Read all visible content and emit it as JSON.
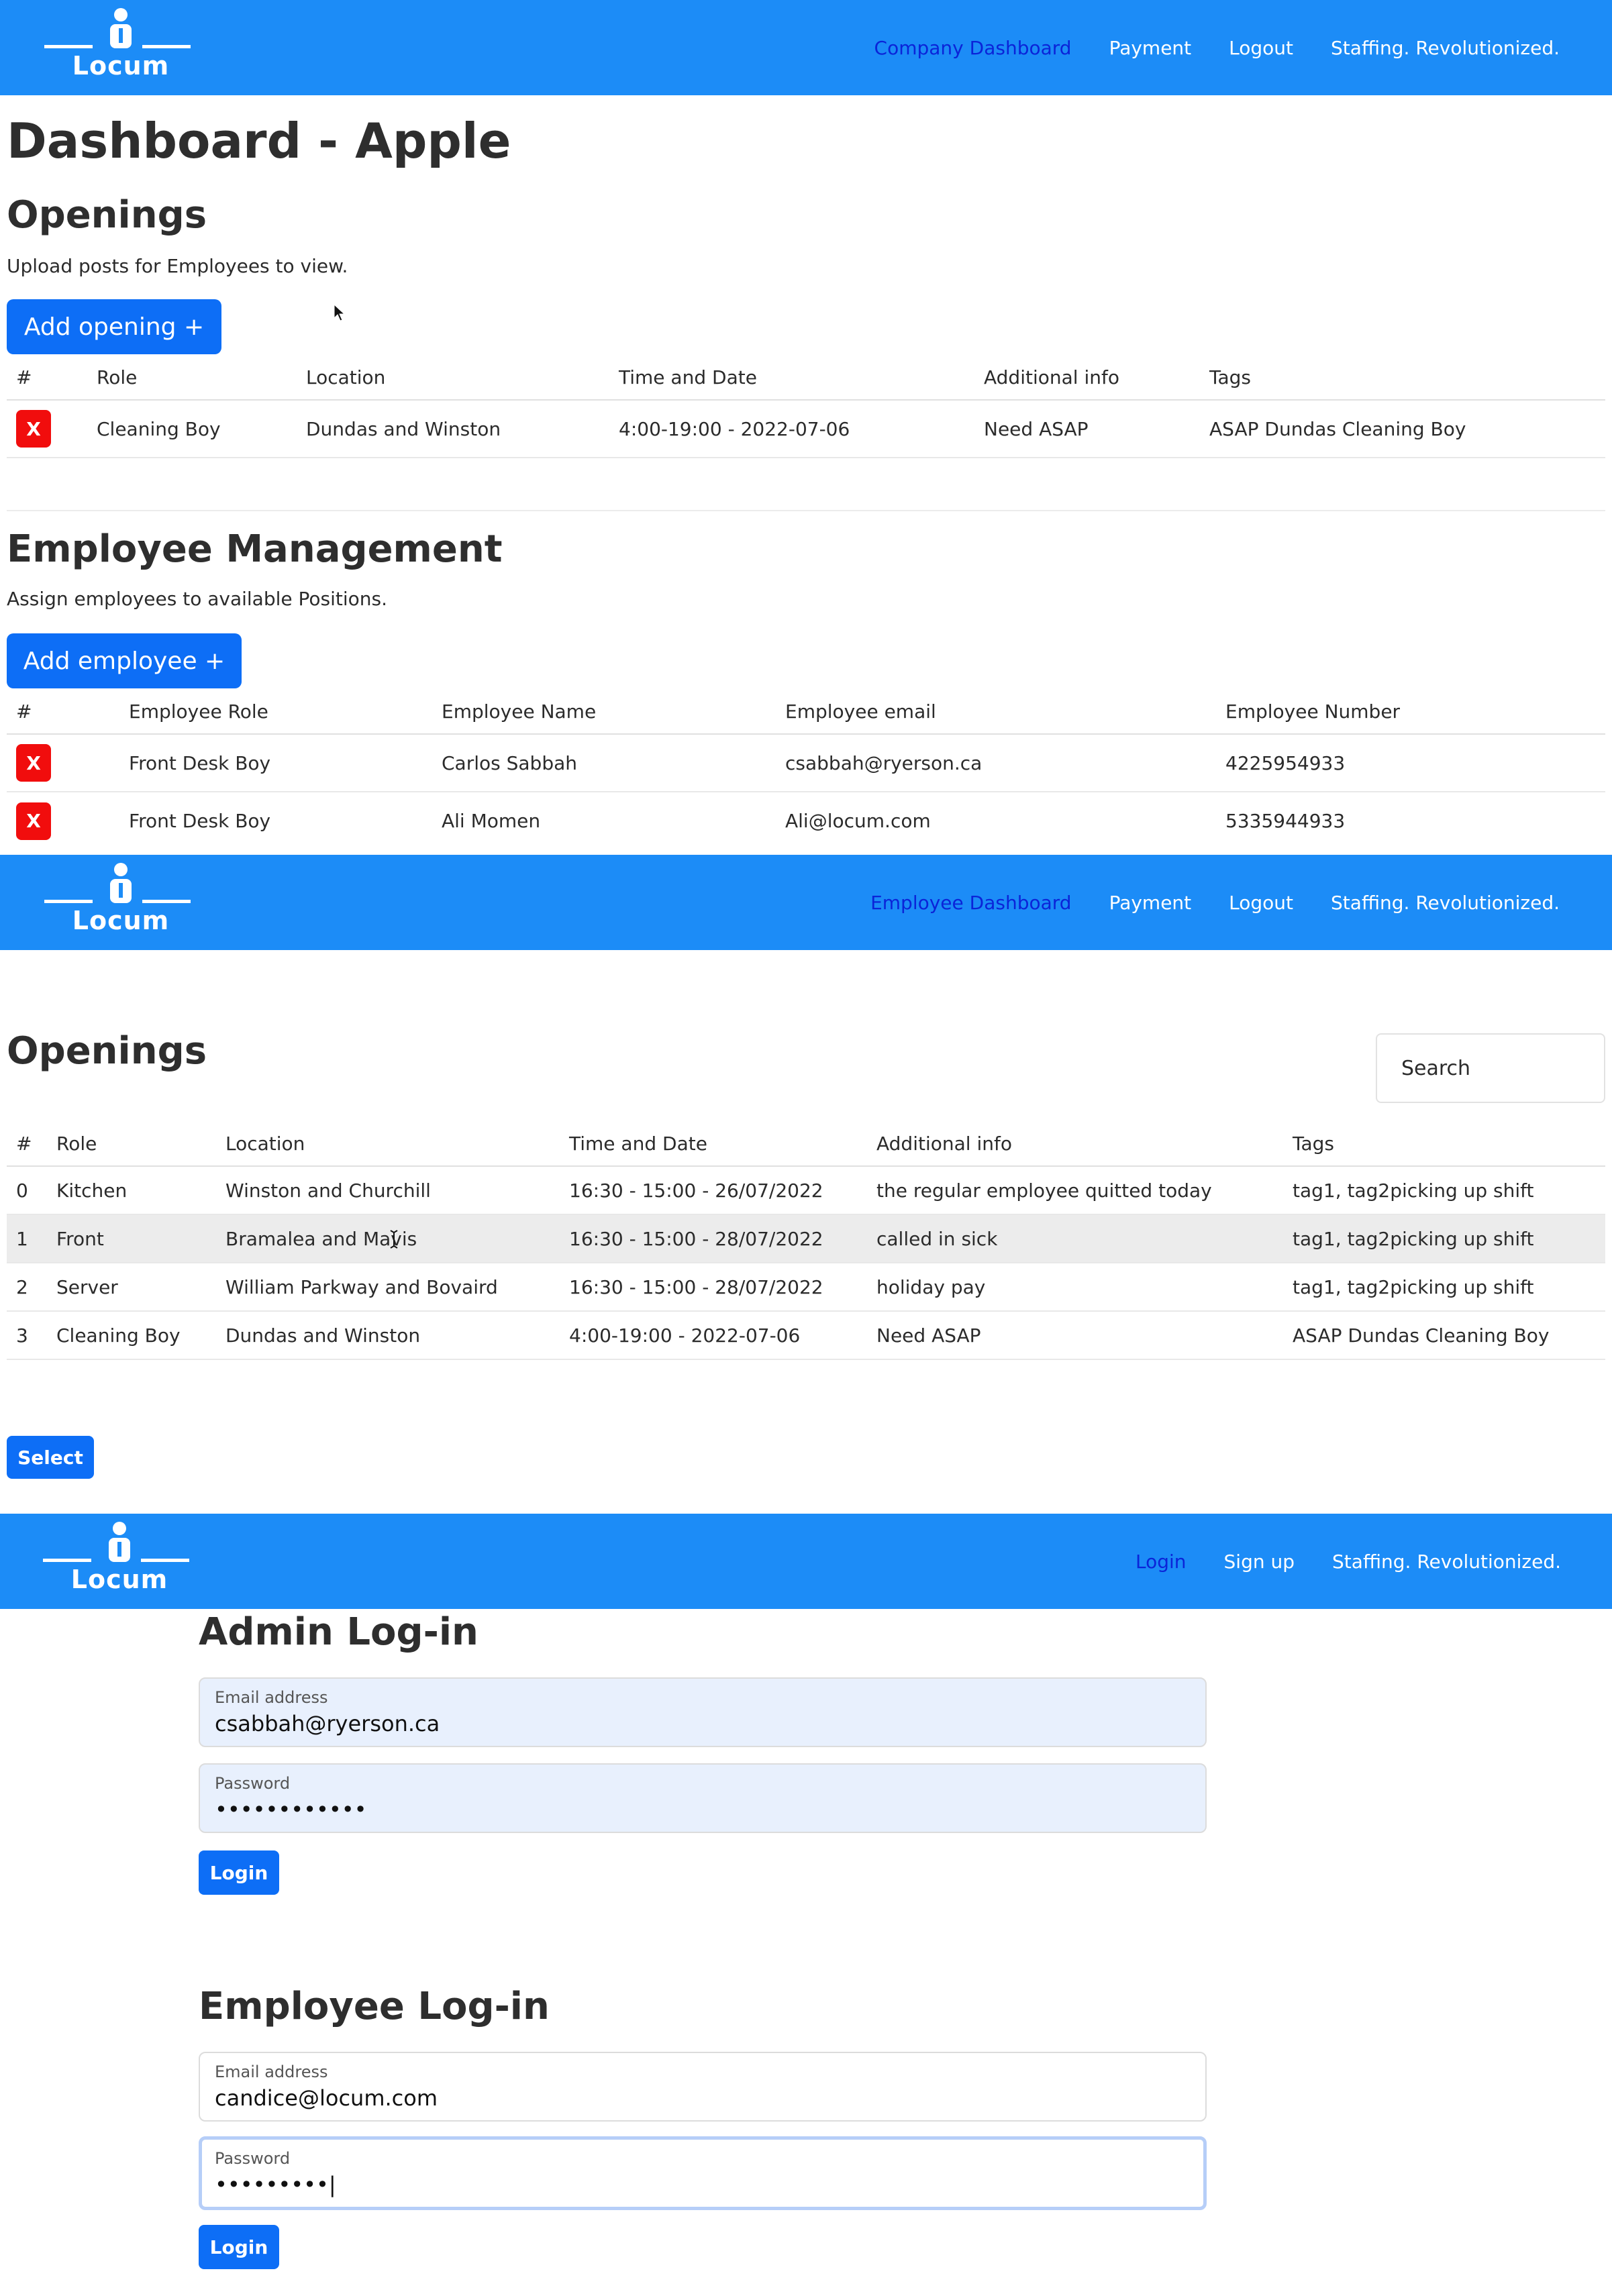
{
  "brand": {
    "name": "Locum"
  },
  "company_nav": {
    "links": [
      "Company Dashboard",
      "Payment",
      "Logout",
      "Staffing. Revolutionized."
    ]
  },
  "company_dashboard": {
    "title": "Dashboard - Apple",
    "openings": {
      "heading": "Openings",
      "subtitle": "Upload posts for Employees to view.",
      "add_button": "Add opening +",
      "columns": [
        "#",
        "Role",
        "Location",
        "Time and Date",
        "Additional info",
        "Tags"
      ],
      "rows": [
        {
          "delete": "X",
          "role": "Cleaning Boy",
          "location": "Dundas and Winston",
          "time": "4:00-19:00 - 2022-07-06",
          "info": "Need ASAP",
          "tags": "ASAP Dundas Cleaning Boy"
        }
      ]
    },
    "employees": {
      "heading": "Employee Management",
      "subtitle": "Assign employees to available Positions.",
      "add_button": "Add employee +",
      "columns": [
        "#",
        "Employee Role",
        "Employee Name",
        "Employee email",
        "Employee Number"
      ],
      "rows": [
        {
          "delete": "X",
          "role": "Front Desk Boy",
          "name": "Carlos Sabbah",
          "email": "csabbah@ryerson.ca",
          "number": "4225954933"
        },
        {
          "delete": "X",
          "role": "Front Desk Boy",
          "name": "Ali Momen",
          "email": "Ali@locum.com",
          "number": "5335944933"
        }
      ]
    }
  },
  "employee_nav": {
    "links": [
      "Employee Dashboard",
      "Payment",
      "Logout",
      "Staffing. Revolutionized."
    ]
  },
  "employee_dashboard": {
    "heading": "Openings",
    "search_placeholder": "Search",
    "columns": [
      "#",
      "Role",
      "Location",
      "Time and Date",
      "Additional info",
      "Tags"
    ],
    "rows": [
      {
        "idx": "0",
        "role": "Kitchen",
        "location": "Winston and Churchill",
        "time": "16:30 - 15:00 - 26/07/2022",
        "info": "the regular employee quitted today",
        "tags": "tag1, tag2picking up shift"
      },
      {
        "idx": "1",
        "role": "Front",
        "location": "Bramalea and Mavis",
        "time": "16:30 - 15:00 - 28/07/2022",
        "info": "called in sick",
        "tags": "tag1, tag2picking up shift"
      },
      {
        "idx": "2",
        "role": "Server",
        "location": "William Parkway and Bovaird",
        "time": "16:30 - 15:00 - 28/07/2022",
        "info": "holiday pay",
        "tags": "tag1, tag2picking up shift"
      },
      {
        "idx": "3",
        "role": "Cleaning Boy",
        "location": "Dundas and Winston",
        "time": "4:00-19:00 - 2022-07-06",
        "info": "Need ASAP",
        "tags": "ASAP Dundas Cleaning Boy"
      }
    ],
    "select_button": "Select"
  },
  "login_nav": {
    "links": [
      "Login",
      "Sign up",
      "Staffing. Revolutionized."
    ]
  },
  "admin_login": {
    "heading": "Admin Log-in",
    "email_label": "Email address",
    "email_value": "csabbah@ryerson.ca",
    "password_label": "Password",
    "password_value": "••••••••••••",
    "button": "Login"
  },
  "employee_login": {
    "heading": "Employee Log-in",
    "email_label": "Email address",
    "email_value": "candice@locum.com",
    "password_label": "Password",
    "password_value": "•••••••••|",
    "button": "Login"
  },
  "colors": {
    "navbar": "#1c8cf7",
    "button": "#0d6ef6",
    "delete": "#f10d0d",
    "active_link": "#0b24d8"
  }
}
